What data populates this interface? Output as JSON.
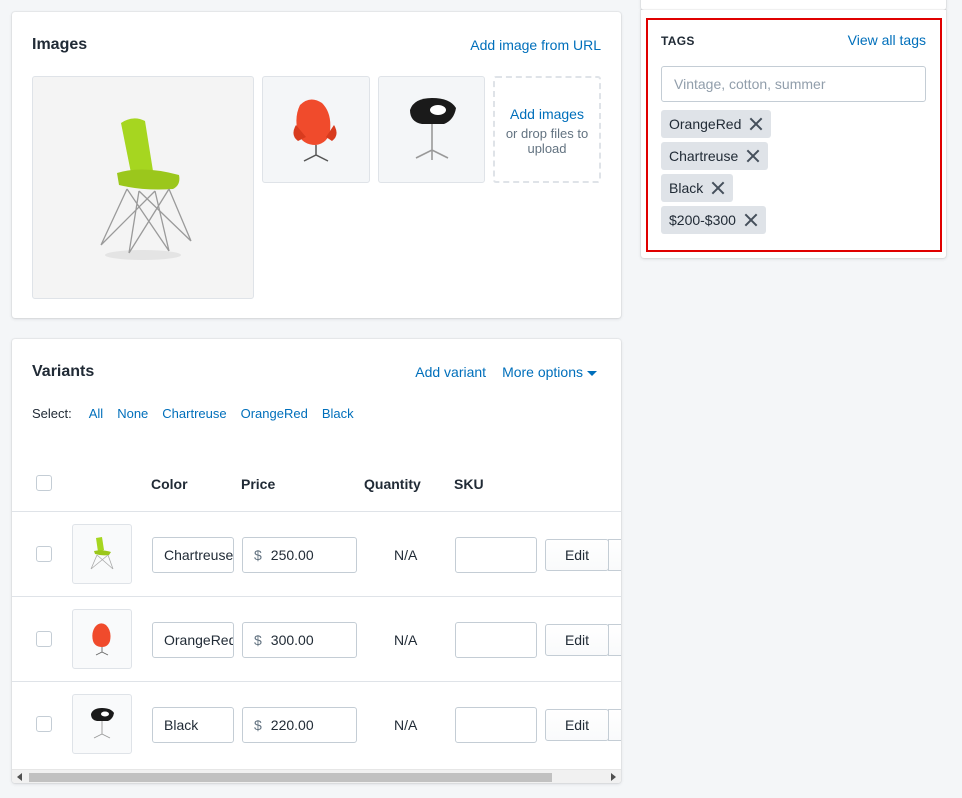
{
  "images": {
    "title": "Images",
    "add_url_link": "Add image from URL",
    "dropzone_action": "Add images",
    "dropzone_hint": "or drop files to upload",
    "items": [
      {
        "name": "chartreuse-chair",
        "color": "#a6d620"
      },
      {
        "name": "orangered-egg-chair",
        "color": "#f04b2c"
      },
      {
        "name": "black-chair",
        "color": "#1a1a1a"
      }
    ]
  },
  "variants": {
    "title": "Variants",
    "add_variant": "Add variant",
    "more_options": "More options",
    "select_label": "Select:",
    "select_options": [
      "All",
      "None",
      "Chartreuse",
      "OrangeRed",
      "Black"
    ],
    "columns": [
      "Color",
      "Price",
      "Quantity",
      "SKU"
    ],
    "rows": [
      {
        "color": "Chartreuse",
        "currency": "$",
        "price": "250.00",
        "quantity": "N/A",
        "edit": "Edit",
        "thumb_color": "#a6d620"
      },
      {
        "color": "OrangeRed",
        "currency": "$",
        "price": "300.00",
        "quantity": "N/A",
        "edit": "Edit",
        "thumb_color": "#f04b2c"
      },
      {
        "color": "Black",
        "currency": "$",
        "price": "220.00",
        "quantity": "N/A",
        "edit": "Edit",
        "thumb_color": "#1a1a1a"
      }
    ]
  },
  "tags": {
    "heading": "TAGS",
    "view_all": "View all tags",
    "placeholder": "Vintage, cotton, summer",
    "items": [
      "OrangeRed",
      "Chartreuse",
      "Black",
      "$200-$300"
    ]
  },
  "colors": {
    "link": "#006fbb",
    "highlight": "#e00000",
    "tag_bg": "#dfe3e8"
  }
}
